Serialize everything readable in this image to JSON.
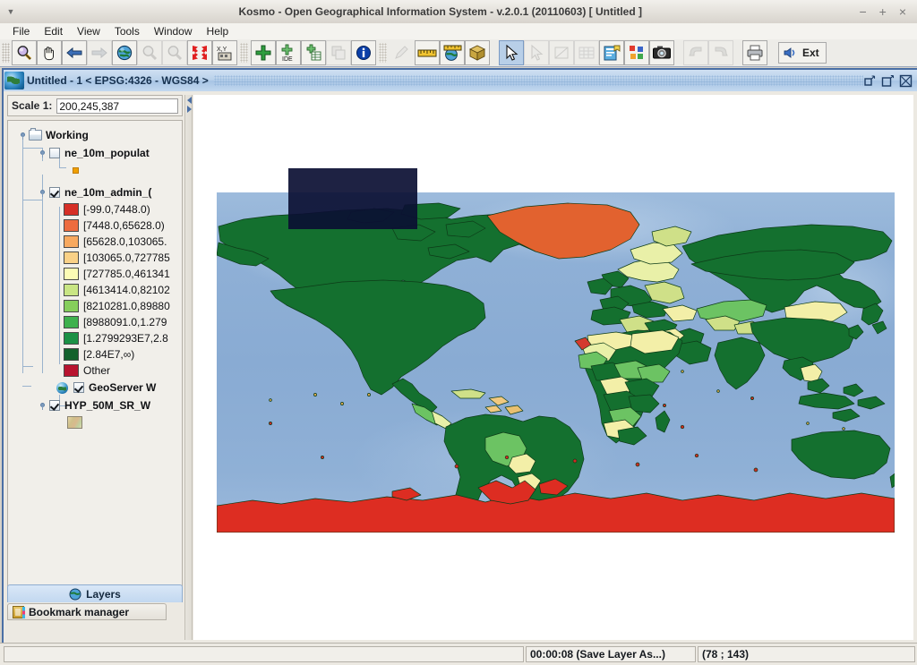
{
  "os_window": {
    "title": "Kosmo - Open Geographical Information System - v.2.0.1 (20110603)  [ Untitled ]",
    "minimize": "−",
    "maximize": "+",
    "close": "×",
    "menu_arrow": "▼"
  },
  "menubar": {
    "items": [
      {
        "label": "File"
      },
      {
        "label": "Edit"
      },
      {
        "label": "View"
      },
      {
        "label": "Tools"
      },
      {
        "label": "Window"
      },
      {
        "label": "Help"
      }
    ]
  },
  "toolbar": {
    "buttons": [
      {
        "name": "zoom-in-icon",
        "title": "Zoom in"
      },
      {
        "name": "pan-hand-icon",
        "title": "Pan"
      },
      {
        "name": "back-arrow-icon",
        "title": "Previous extent"
      },
      {
        "name": "forward-arrow-icon",
        "title": "Next extent"
      },
      {
        "name": "globe-full-extent-icon",
        "title": "Zoom to full extent"
      },
      {
        "name": "zoom-layer-icon",
        "title": "Zoom to layer"
      },
      {
        "name": "zoom-selected-icon",
        "title": "Zoom to selection"
      },
      {
        "name": "zoom-fit-arrows-icon",
        "title": "Fit"
      },
      {
        "name": "xy-coordinate-icon",
        "title": "Go to X,Y"
      },
      {
        "name": "add-layer-plus-icon",
        "title": "Add layer"
      },
      {
        "name": "add-ide-layer-icon",
        "title": "Add IDE layer"
      },
      {
        "name": "add-table-layer-icon",
        "title": "Add table layer"
      },
      {
        "name": "layer-copy-icon",
        "title": "Copy layer"
      },
      {
        "name": "info-icon",
        "title": "Information"
      },
      {
        "name": "edit-pencil-icon",
        "title": "Edit"
      },
      {
        "name": "measure-ruler-icon",
        "title": "Measure"
      },
      {
        "name": "measure-globe-icon",
        "title": "Measure on globe"
      },
      {
        "name": "package-box-icon",
        "title": "Geoprocessing"
      },
      {
        "name": "select-cursor-icon",
        "title": "Select"
      },
      {
        "name": "select-feature-icon",
        "title": "Select feature"
      },
      {
        "name": "edit-geometry-icon",
        "title": "Edit geometry"
      },
      {
        "name": "attribute-table-icon",
        "title": "Attribute table"
      },
      {
        "name": "new-report-icon",
        "title": "New report"
      },
      {
        "name": "symbology-icon",
        "title": "Symbology"
      },
      {
        "name": "camera-icon",
        "title": "Screenshot"
      },
      {
        "name": "undo-icon",
        "title": "Undo"
      },
      {
        "name": "redo-icon",
        "title": "Redo"
      },
      {
        "name": "print-icon",
        "title": "Print"
      }
    ],
    "ext_label": "Ext"
  },
  "inner_window": {
    "title": "Untitled - 1 < EPSG:4326 - WGS84 >",
    "restore_icon": "restore-window-icon",
    "maximize_icon": "maximize-window-icon",
    "close_icon": "close-window-icon"
  },
  "left_panel": {
    "scale": {
      "label": "Scale 1:",
      "value": "200,245,387"
    },
    "tree": {
      "root": {
        "label": "Working",
        "icon": "folder-icon"
      },
      "layers": [
        {
          "label": "ne_10m_populat",
          "checked": false,
          "symbol_color": "#f0a000",
          "symbol_type": "point"
        },
        {
          "label": "ne_10m_admin_(",
          "checked": true,
          "legend": [
            {
              "color": "#d62f26",
              "label": "[-99.0,7448.0)"
            },
            {
              "color": "#ee6c3f",
              "label": "[7448.0,65628.0)"
            },
            {
              "color": "#f8a95f",
              "label": "[65628.0,103065."
            },
            {
              "color": "#fad187",
              "label": "[103065.0,727785"
            },
            {
              "color": "#fcfbb5",
              "label": "[727785.0,461341"
            },
            {
              "color": "#c9e583",
              "label": "[4613414.0,82102"
            },
            {
              "color": "#86ce5b",
              "label": "[8210281.0,89880"
            },
            {
              "color": "#3fb14d",
              "label": "[8988091.0,1.279"
            },
            {
              "color": "#1b9145",
              "label": "[1.2799293E7,2.8"
            },
            {
              "color": "#14622c",
              "label": "[2.84E7,∞)"
            },
            {
              "color": "#b8132f",
              "label": "Other"
            }
          ]
        },
        {
          "label": "GeoServer W",
          "checked": true,
          "icon": "wms-globe-icon"
        },
        {
          "label": "HYP_50M_SR_W",
          "checked": true,
          "icon": "raster-swatch-icon"
        }
      ]
    },
    "tabs": {
      "layers": {
        "label": "Layers",
        "icon": "globe-icon",
        "active": true
      },
      "bookmark_manager": {
        "label": "Bookmark manager",
        "icon": "bookmark-icon",
        "active": false
      }
    }
  },
  "map": {
    "ocean_color": "#8aaed4",
    "selection_rect_color": "#0b0f33",
    "graticule": false
  },
  "statusbar": {
    "message_field": "",
    "task": "00:00:08 (Save Layer As...)",
    "coordinates": "(78 ; 143)"
  }
}
